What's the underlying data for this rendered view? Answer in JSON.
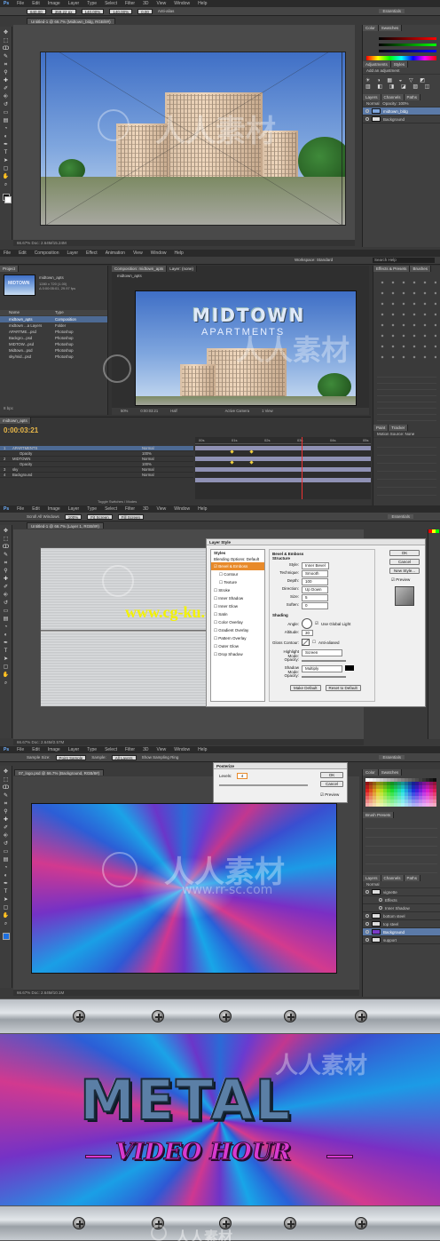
{
  "ps1": {
    "menu": [
      "File",
      "Edit",
      "Image",
      "Layer",
      "Type",
      "Select",
      "Filter",
      "3D",
      "View",
      "Window",
      "Help"
    ],
    "options": {
      "w": "640.00",
      "h": "359.22 px",
      "pct1": "140.00%",
      "pct2": "140.00%",
      "angle": "0.00",
      "anti_alias": "Anti-alias"
    },
    "tab": "Untitled-1 @ 66.7% (Midtown_bldg, RGB/8#)",
    "workspace": "Essentials",
    "color_tabs": [
      "Color",
      "Swatches"
    ],
    "adj_tabs": [
      "Adjustments",
      "Styles"
    ],
    "adj_label": "Add an adjustment",
    "layer_tabs": [
      "Layers",
      "Channels",
      "Paths"
    ],
    "blend": "Normal",
    "opacity": "Opacity: 100%",
    "layers": [
      "midtown_bldg",
      "Background"
    ],
    "status": "66.67%     Doc: 2.64M/15.24M"
  },
  "ae": {
    "menu": [
      "File",
      "Edit",
      "Composition",
      "Layer",
      "Effect",
      "Animation",
      "View",
      "Window",
      "Help"
    ],
    "workspace": "Workspace: Standard",
    "search": "Search Help",
    "project_tab": "Project",
    "project_thumb_text": "MIDTOWN",
    "project_item": "midtown_apts",
    "project_info": "1280 x 720 (1.00)\nΔ 0:00:05:01, 29.97 fps",
    "project_cols": [
      "Name",
      "Type"
    ],
    "project_rows": [
      {
        "name": "midtown_apts",
        "type": "Composition"
      },
      {
        "name": "midtown ...a Layers",
        "type": "Folder"
      },
      {
        "name": "APARTME...psd",
        "type": "Photoshop"
      },
      {
        "name": "Backgro...psd",
        "type": "Photoshop"
      },
      {
        "name": "MIDTOW...psd",
        "type": "Photoshop"
      },
      {
        "name": "Midtown...psd",
        "type": "Photoshop"
      },
      {
        "name": "sky/mid...psd",
        "type": "Photoshop"
      }
    ],
    "comp_tab": "Composition: midtown_apts",
    "layer_tab": "Layer: (none)",
    "comp_crumb": "midtown_apts",
    "title_line1": "MIDTOWN",
    "title_line2": "APARTMENTS",
    "comp_footer": [
      "50%",
      "0:00:03:21",
      "Half",
      "Active Camera",
      "1 View"
    ],
    "effects_tab": "Effects & Presets",
    "brushes_tab": "Brushes",
    "paint_tab": "Paint",
    "tracker_tab": "Tracker",
    "motion_source": "Motion Source:",
    "motion_none": "None",
    "timeline_tab": "midtown_apts",
    "timecode": "0:00:03:21",
    "tl_layers": [
      {
        "num": "1",
        "name": "APARTMENTS",
        "mode": "Normal"
      },
      {
        "num": "",
        "name": "Opacity",
        "mode": "100%"
      },
      {
        "num": "2",
        "name": "MIDTOWN",
        "mode": "Normal"
      },
      {
        "num": "",
        "name": "Opacity",
        "mode": "100%"
      },
      {
        "num": "3",
        "name": "sky",
        "mode": "Normal"
      },
      {
        "num": "4",
        "name": "Background",
        "mode": "Normal"
      }
    ],
    "tl_ruler": [
      "00s",
      "01s",
      "02s",
      "03s",
      "04s",
      "05s"
    ],
    "tl_footer": "Toggle Switches / Modes"
  },
  "ps2": {
    "menu": [
      "File",
      "Edit",
      "Image",
      "Layer",
      "Type",
      "Select",
      "Filter",
      "3D",
      "View",
      "Window",
      "Help"
    ],
    "options": [
      "Scroll All Windows",
      "100%",
      "Fit Screen",
      "Fill Screen"
    ],
    "tab": "Untitled-1 @ 66.7% (Layer 1, RGB/8#)",
    "workspace": "Essentials",
    "dialog_title": "Layer Style",
    "styles_header": "Styles",
    "blending": "Blending Options: Default",
    "style_list": [
      "Bevel & Emboss",
      "Contour",
      "Texture",
      "Stroke",
      "Inner Shadow",
      "Inner Glow",
      "Satin",
      "Color Overlay",
      "Gradient Overlay",
      "Pattern Overlay",
      "Outer Glow",
      "Drop Shadow"
    ],
    "bevel_header": "Bevel & Emboss",
    "structure": "Structure",
    "fields": [
      {
        "label": "Style:",
        "value": "Inner Bevel"
      },
      {
        "label": "Technique:",
        "value": "Smooth"
      },
      {
        "label": "Depth:",
        "value": "100"
      },
      {
        "label": "Direction:",
        "value": "Up   Down"
      },
      {
        "label": "Size:",
        "value": "5"
      },
      {
        "label": "Soften:",
        "value": "0"
      }
    ],
    "shading": "Shading",
    "angle_label": "Angle:",
    "global_light": "Use Global Light",
    "altitude_label": "Altitude:",
    "altitude": "30",
    "gloss_label": "Gloss Contour:",
    "anti_aliased": "Anti-aliased",
    "highlight_label": "Highlight Mode:",
    "highlight": "Screen",
    "shadow_label": "Shadow Mode:",
    "shadow": "Multiply",
    "opacity_label": "Opacity:",
    "make_default": "Make Default",
    "reset_default": "Reset to Default",
    "ok": "OK",
    "cancel": "Cancel",
    "new_style": "New Style...",
    "preview": "Preview",
    "watermark_url": "www.cg-ku.com",
    "status": "66.67%     Doc: 2.64M/2.57M"
  },
  "ps3": {
    "menu": [
      "File",
      "Edit",
      "Image",
      "Layer",
      "Type",
      "Select",
      "Filter",
      "3D",
      "View",
      "Window",
      "Help"
    ],
    "options": [
      "Sample Size:",
      "Point Sample",
      "Sample:",
      "All Layers",
      "Show Sampling Ring"
    ],
    "tab": "07_logo.psd @ 66.7% (Background, RGB/8#)",
    "workspace": "Essentials",
    "dialog_title": "Posterize",
    "levels_label": "Levels:",
    "levels_value": "4",
    "ok": "OK",
    "cancel": "Cancel",
    "preview": "Preview",
    "color_tabs": [
      "Color",
      "Swatches"
    ],
    "brush_tab": "Brush Presets",
    "layer_tabs": [
      "Layers",
      "Channels",
      "Paths"
    ],
    "blend": "Normal",
    "layers": [
      "vignette",
      "Effects",
      "Inner Shadow",
      "bottom steel",
      "top steel",
      "Background",
      "support"
    ],
    "status": "66.67%     Doc: 2.64M/10.1M"
  },
  "banner": {
    "line1": "METAL",
    "line2": "VIDEO HOUR",
    "watermark": "人人素材"
  },
  "watermark": {
    "cn": "人人素材",
    "url": "www.rr-sc.com"
  },
  "colors": {
    "accent": "#e88a2a",
    "selection": "#5b7aa8",
    "banner_text": "#5b7fa6",
    "script": "#d83ad0"
  }
}
